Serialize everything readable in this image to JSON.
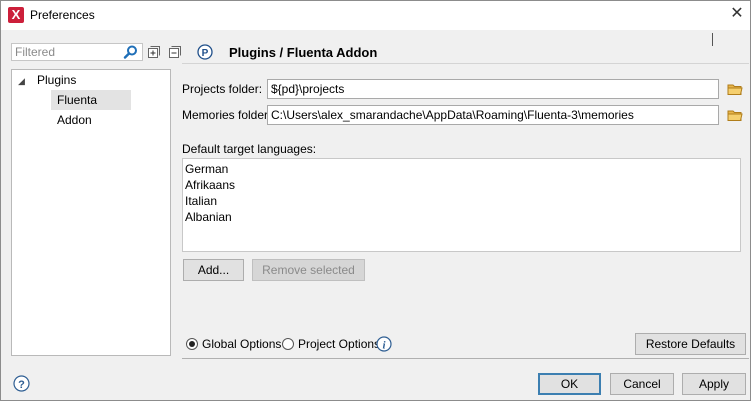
{
  "window": {
    "title": "Preferences",
    "close_glyph": "✕"
  },
  "sidebar": {
    "filter_placeholder": "Filtered",
    "tree": {
      "root_label": "Plugins",
      "toggle_glyph": "◢",
      "child_label": "Fluenta Addon"
    }
  },
  "page": {
    "title": "Plugins / Fluenta Addon"
  },
  "form": {
    "projects_label": "Projects folder:",
    "projects_value": "${pd}\\projects",
    "memories_label": "Memories folder:",
    "memories_value": "C:\\Users\\alex_smarandache\\AppData\\Roaming\\Fluenta-3\\memories",
    "languages_label": "Default target languages:",
    "languages": [
      "German",
      "Afrikaans",
      "Italian",
      "Albanian"
    ],
    "add_button": "Add...",
    "remove_button": "Remove selected"
  },
  "options": {
    "global_label": "Global Options",
    "project_label": "Project Options",
    "selected": "global",
    "restore_button": "Restore Defaults"
  },
  "footer": {
    "ok_button": "OK",
    "cancel_button": "Cancel",
    "apply_button": "Apply"
  },
  "colors": {
    "accent": "#1f6fb8",
    "app_icon": "#cc1f3a",
    "folder": "#e8b54a"
  },
  "icons": [
    "app-icon",
    "search-icon",
    "expand-all-icon",
    "collapse-all-icon",
    "p-icon",
    "folder-icon",
    "info-icon",
    "help-icon",
    "close-icon"
  ]
}
